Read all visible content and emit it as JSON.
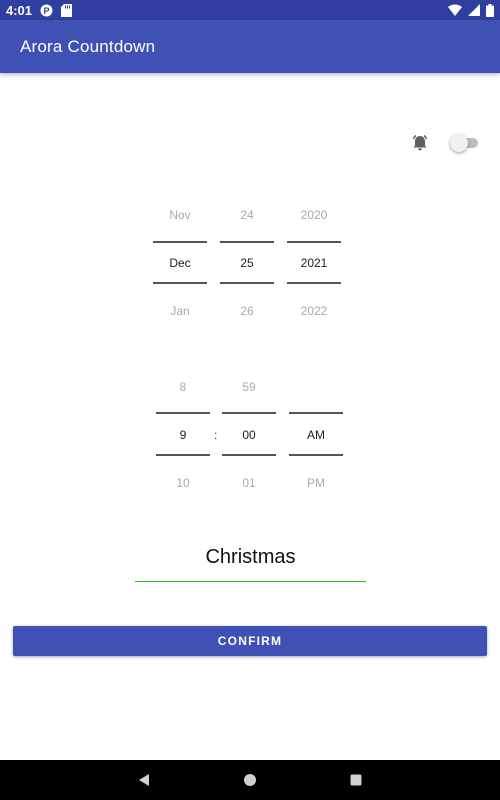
{
  "status_bar": {
    "time": "4:01"
  },
  "app_bar": {
    "title": "Arora Countdown"
  },
  "colors": {
    "primary": "#3f51b5",
    "primary_dark": "#303f9f",
    "field_underline": "#2bb52b"
  },
  "date_picker": {
    "month": {
      "prev": "Nov",
      "value": "Dec",
      "next": "Jan"
    },
    "day": {
      "prev": "24",
      "value": "25",
      "next": "26"
    },
    "year": {
      "prev": "2020",
      "value": "2021",
      "next": "2022"
    }
  },
  "time_picker": {
    "hour": {
      "prev": "8",
      "value": "9",
      "next": "10"
    },
    "minute": {
      "prev": "59",
      "value": "00",
      "next": "01"
    },
    "ampm": {
      "prev": "",
      "value": "AM",
      "next": "PM"
    },
    "separator": ":"
  },
  "event_name": {
    "value": "Christmas"
  },
  "confirm_button": {
    "label": "CONFIRM"
  },
  "alarm": {
    "icon": "alarm-icon",
    "enabled": false
  }
}
